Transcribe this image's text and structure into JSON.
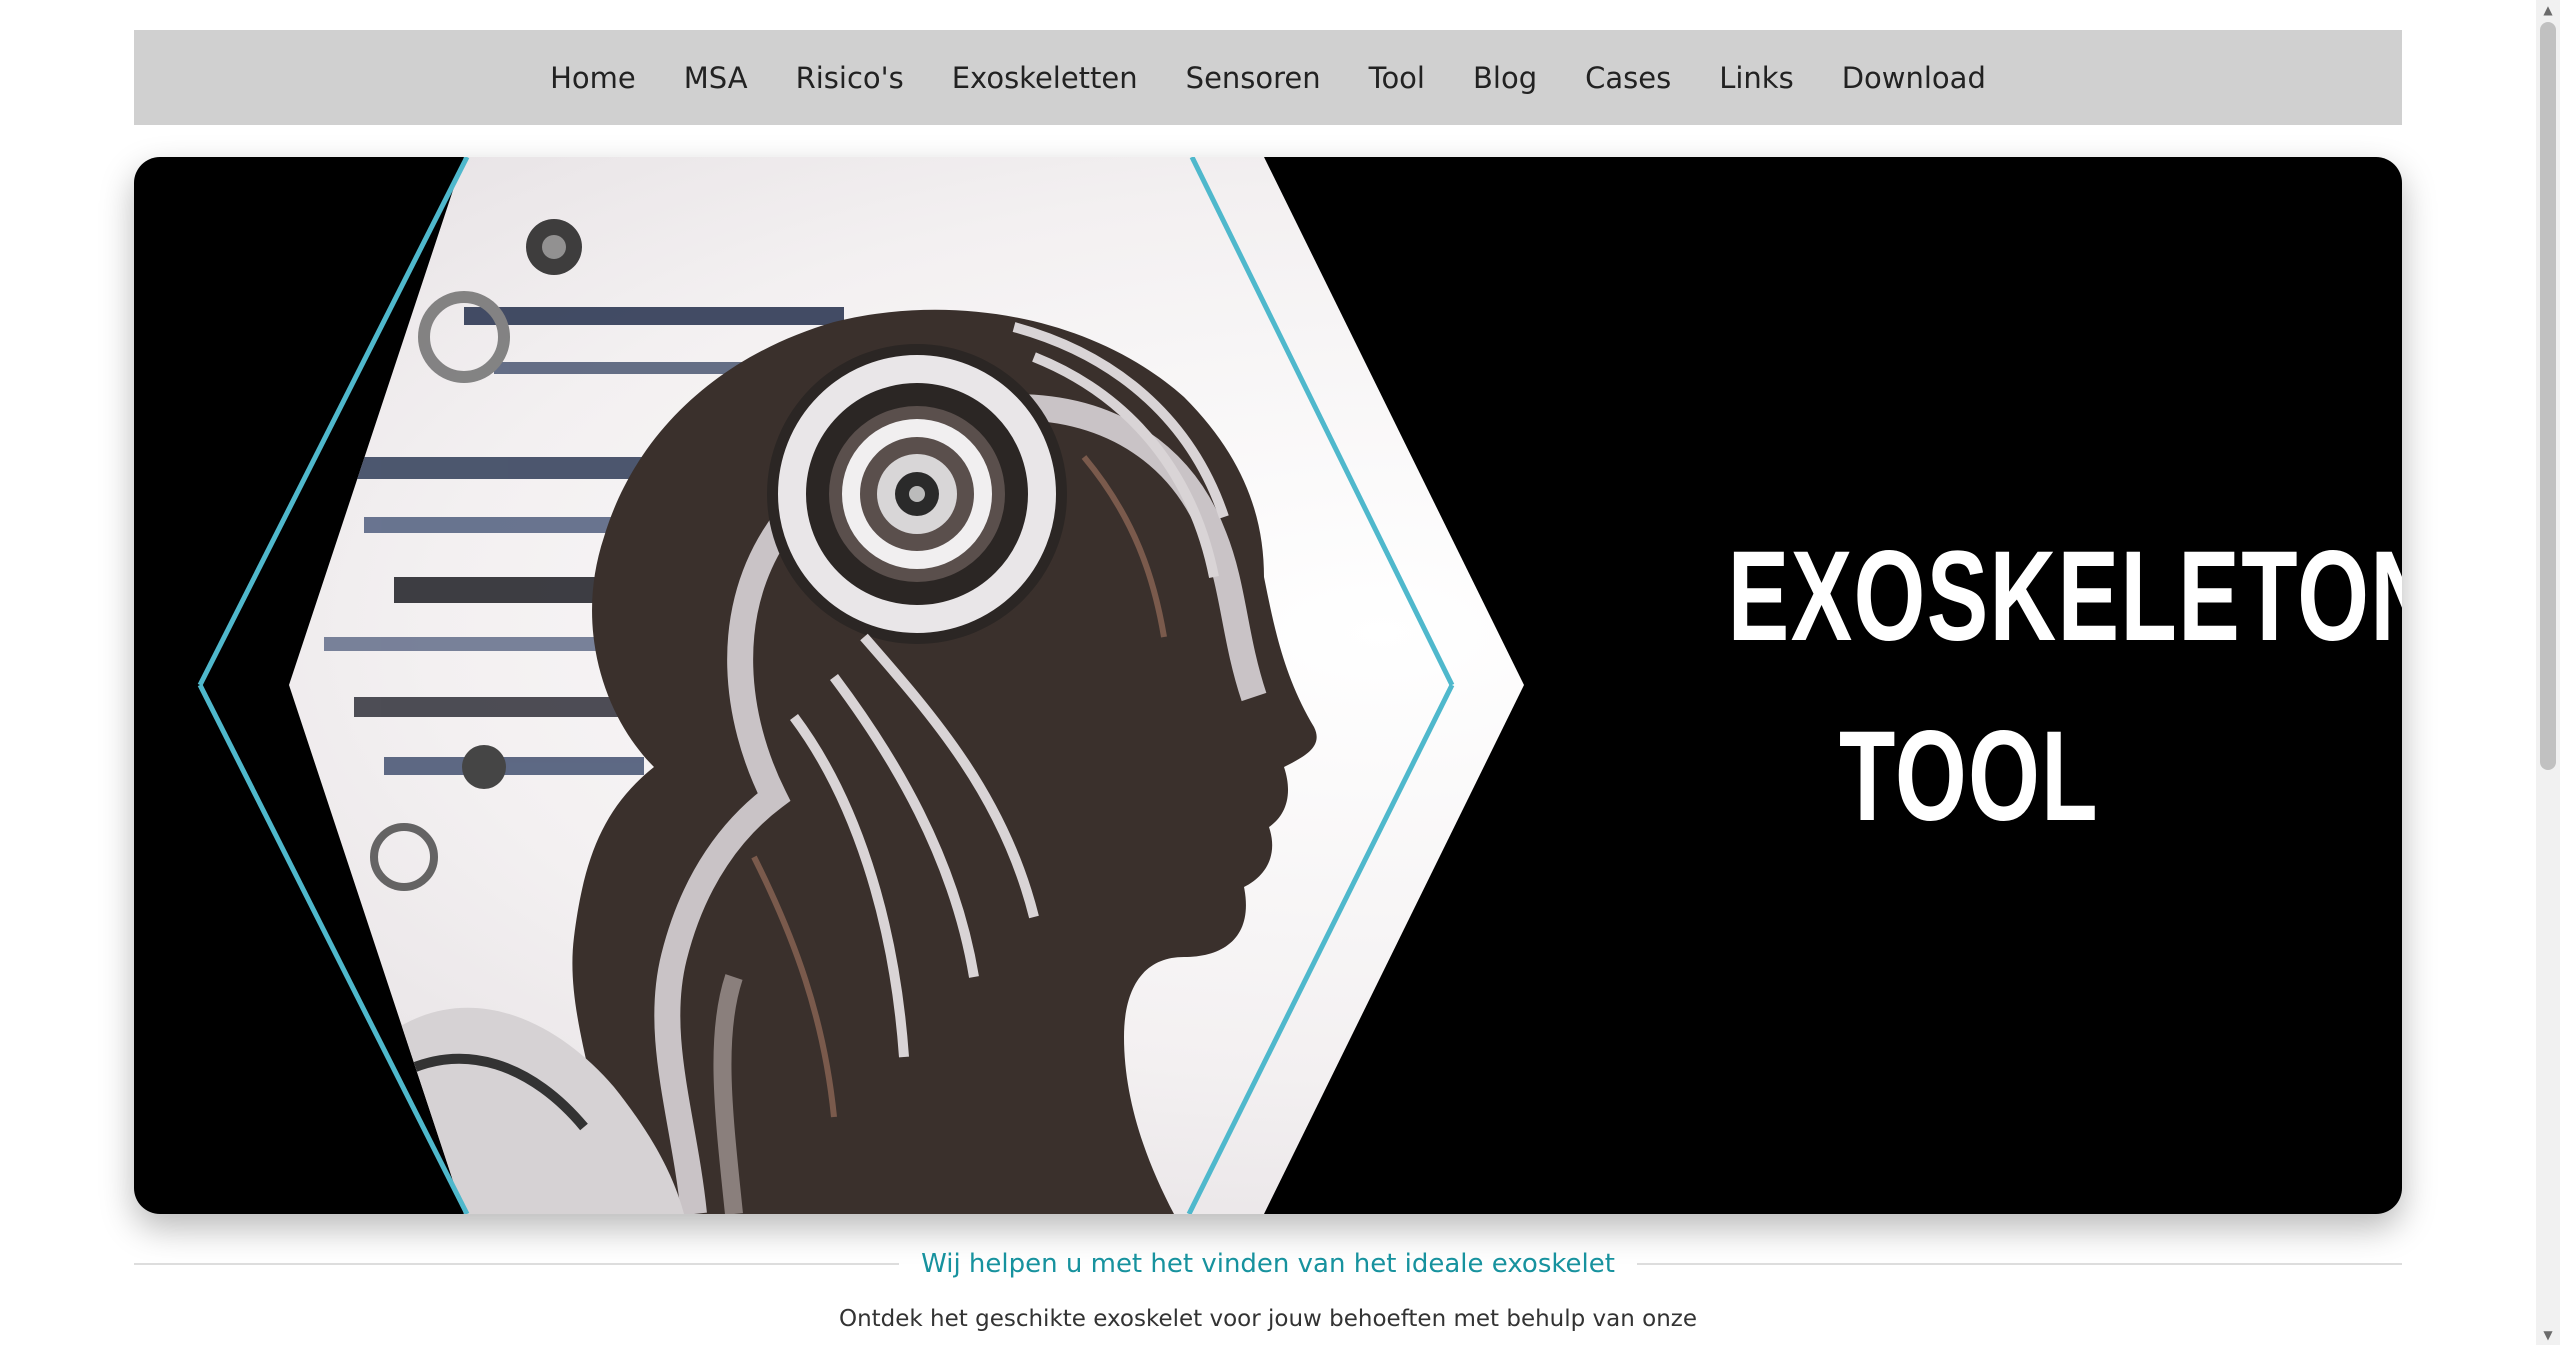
{
  "nav": {
    "items": [
      {
        "label": "Home"
      },
      {
        "label": "MSA"
      },
      {
        "label": "Risico's"
      },
      {
        "label": "Exoskeletten"
      },
      {
        "label": "Sensoren"
      },
      {
        "label": "Tool"
      },
      {
        "label": "Blog"
      },
      {
        "label": "Cases"
      },
      {
        "label": "Links"
      },
      {
        "label": "Download"
      }
    ]
  },
  "hero": {
    "title_line1": "EXOSKELETON",
    "title_line2": "TOOL",
    "image_subject": "robot-head-profile-illustration",
    "accent_color": "#4fb8cc"
  },
  "main": {
    "heading": "Wij helpen u met het vinden van het ideale exoskelet",
    "intro": "Ontdek het geschikte exoskelet voor jouw behoeften met behulp van onze"
  },
  "colors": {
    "nav_bg": "#d0d0d0",
    "heading_accent": "#17929e",
    "hero_bg": "#000000"
  }
}
